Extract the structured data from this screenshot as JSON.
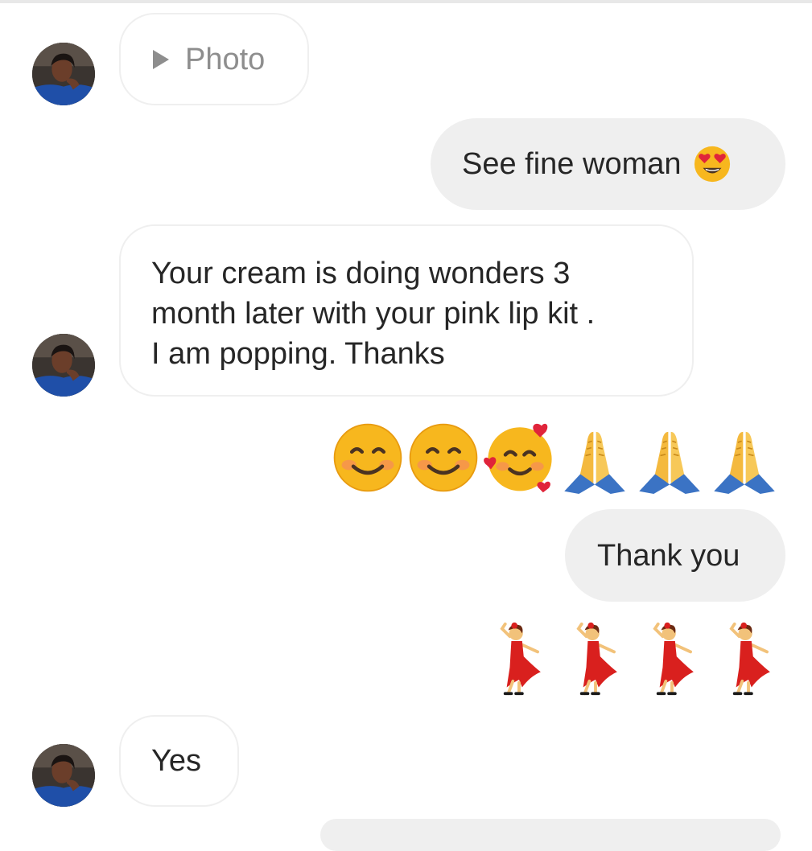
{
  "messages": [
    {
      "from": "them",
      "type": "photo",
      "label": "Photo",
      "icon": "play-icon"
    },
    {
      "from": "me",
      "text": "See fine woman",
      "emoji": "heart-eyes-emoji"
    },
    {
      "from": "them",
      "lines": [
        "Your cream is doing wonders 3",
        "month later with your pink lip kit .",
        "I am popping. Thanks"
      ]
    },
    {
      "from": "me",
      "type": "emoji",
      "emoji": [
        "smiling-face-emoji",
        "smiling-face-emoji",
        "smiling-face-with-hearts-emoji",
        "folded-hands-emoji",
        "folded-hands-emoji",
        "folded-hands-emoji"
      ]
    },
    {
      "from": "me",
      "text": "Thank you"
    },
    {
      "from": "me",
      "type": "emoji",
      "emoji": [
        "dancer-emoji",
        "dancer-emoji",
        "dancer-emoji",
        "dancer-emoji"
      ]
    },
    {
      "from": "them",
      "text": "Yes"
    }
  ],
  "colors": {
    "incoming_bubble_border": "#efefef",
    "outgoing_bubble": "#efefef",
    "text": "#262626",
    "muted_text": "#8e8e8e"
  }
}
